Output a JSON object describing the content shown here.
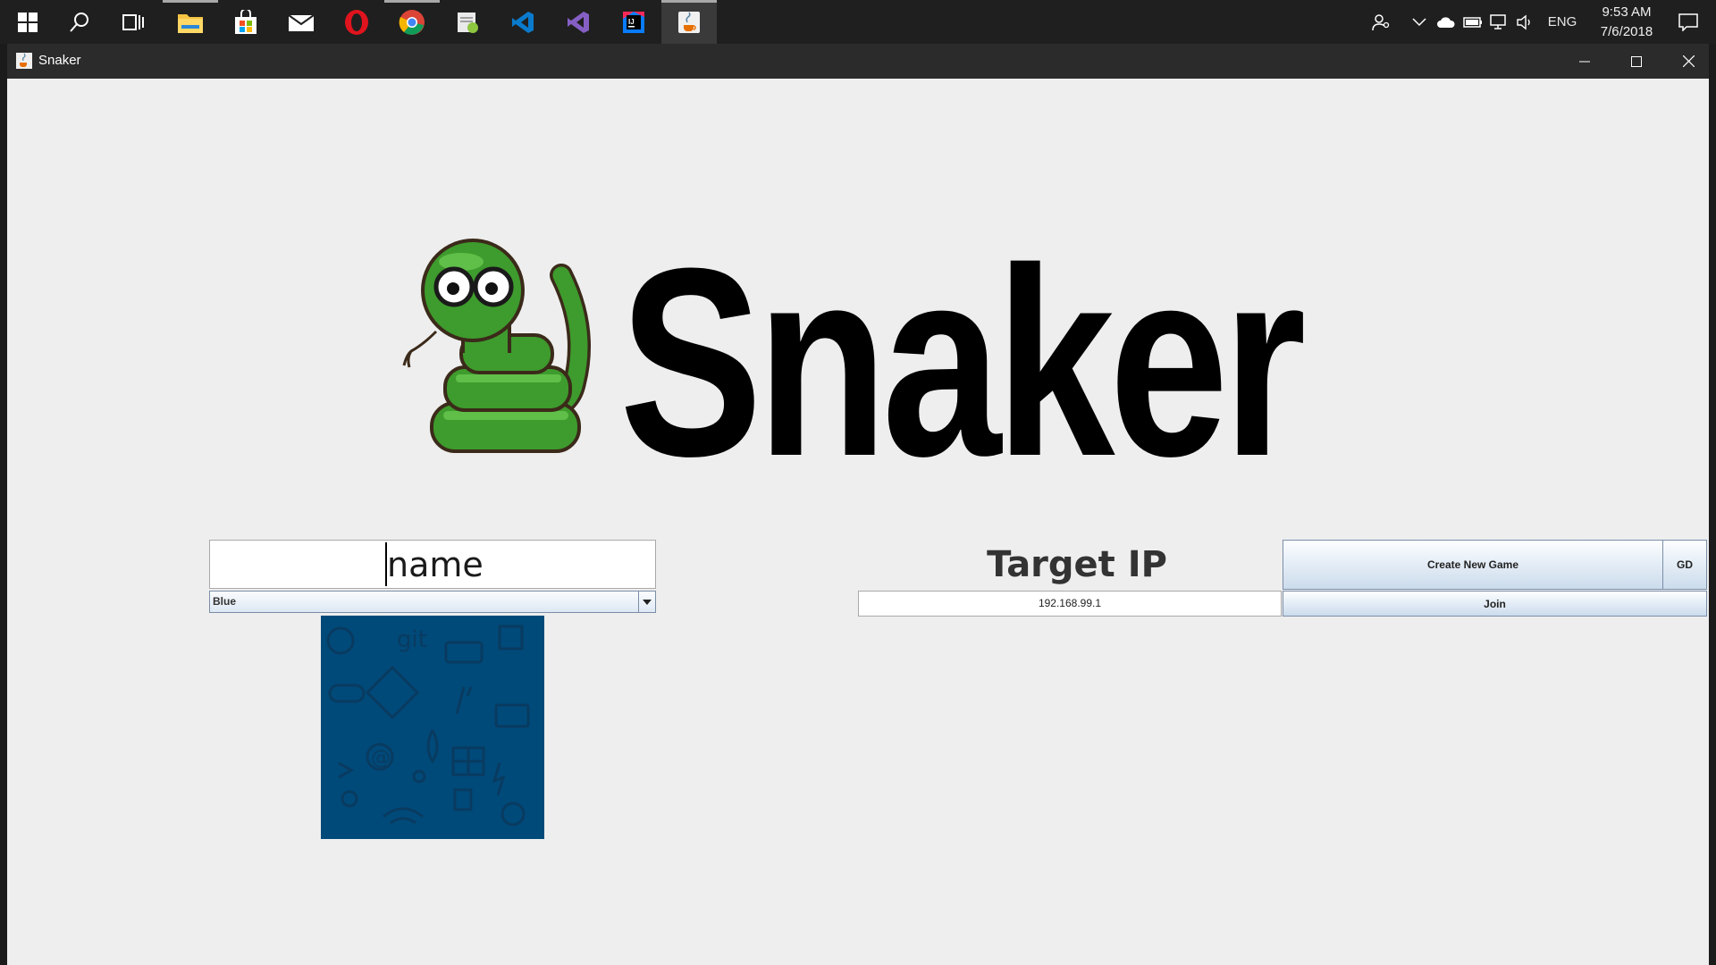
{
  "taskbar": {
    "apps": [
      {
        "name": "start-button"
      },
      {
        "name": "search-button"
      },
      {
        "name": "task-view-button"
      },
      {
        "name": "file-explorer-app"
      },
      {
        "name": "store-app"
      },
      {
        "name": "mail-app"
      },
      {
        "name": "opera-app"
      },
      {
        "name": "chrome-app"
      },
      {
        "name": "notepad-plus-app"
      },
      {
        "name": "vscode-app"
      },
      {
        "name": "visual-studio-app"
      },
      {
        "name": "intellij-app"
      },
      {
        "name": "java-app"
      }
    ],
    "language": "ENG",
    "time": "9:53 AM",
    "date": "7/6/2018"
  },
  "window": {
    "title": "Snaker"
  },
  "logo": {
    "text": "Snaker"
  },
  "form": {
    "name_value": "name",
    "color_selected": "Blue",
    "target_ip_label": "Target IP",
    "ip_value": "192.168.99.1",
    "create_button": "Create New Game",
    "gd_button": "GD",
    "join_button": "Join"
  },
  "colors": {
    "window_bg": "#eeeeee",
    "preview_blue": "#004a7a",
    "snake_green": "#3d9a2b",
    "titlebar": "#2b2b2b"
  }
}
